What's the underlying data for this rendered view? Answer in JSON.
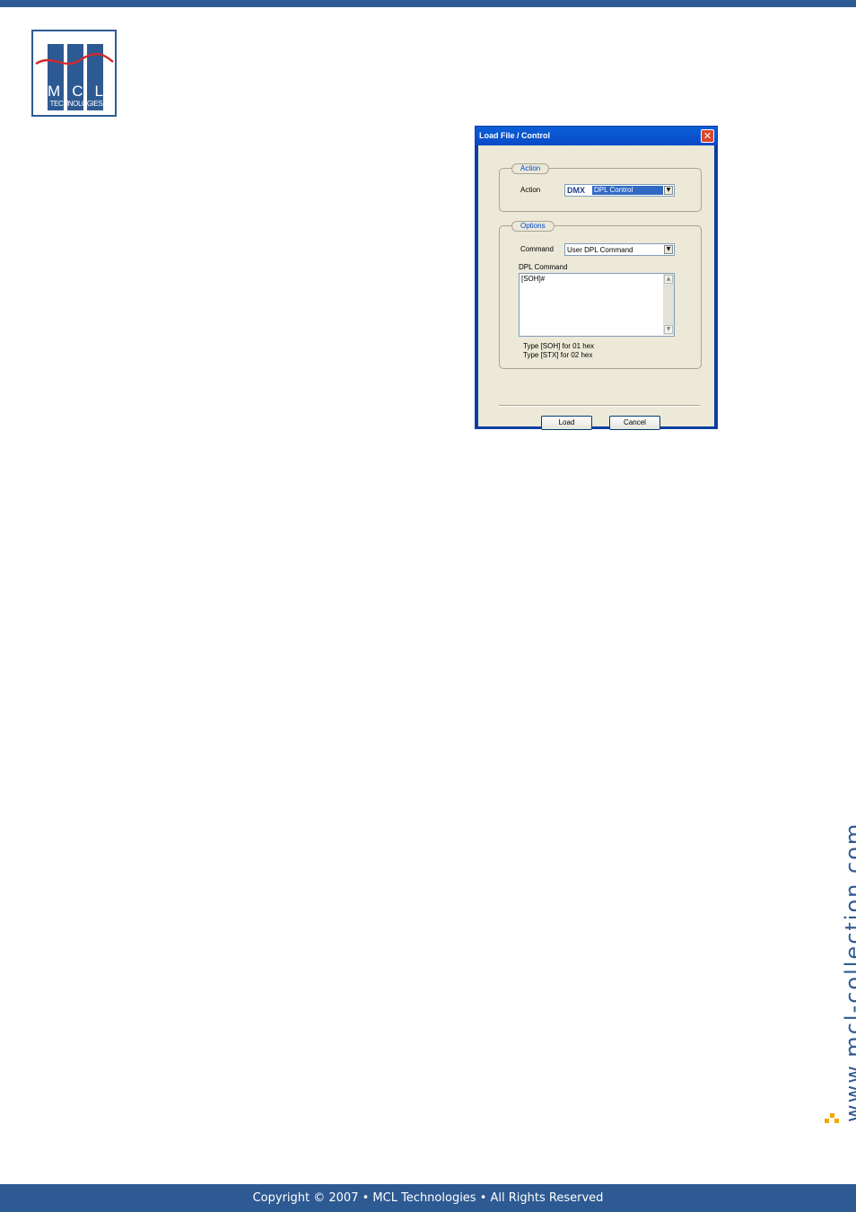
{
  "brand": {
    "logo_letters": [
      "M",
      "C",
      "L"
    ],
    "logo_subtitle": "TECHNOLOGIES",
    "website": "www.mcl-collection.com",
    "color_primary": "#2e5a93",
    "color_accent": "#d4282d",
    "color_mark": "#f0a800"
  },
  "dialog": {
    "title": "Load File / Control",
    "close_icon": "close-icon",
    "action_group": {
      "title": "Action",
      "action_label": "Action",
      "action_prefix": "DMX",
      "action_value": "DPL Control"
    },
    "options_group": {
      "title": "Options",
      "command_label": "Command",
      "command_value": "User DPL Command",
      "dpl_label": "DPL Command",
      "dpl_value": "[SOH]#",
      "hint_1": "Type [SOH] for 01 hex",
      "hint_2": "Type [STX] for 02 hex"
    },
    "load_button": "Load",
    "cancel_button": "Cancel"
  },
  "footer": {
    "copyright": "Copyright © 2007 • MCL Technologies • All Rights Reserved"
  }
}
